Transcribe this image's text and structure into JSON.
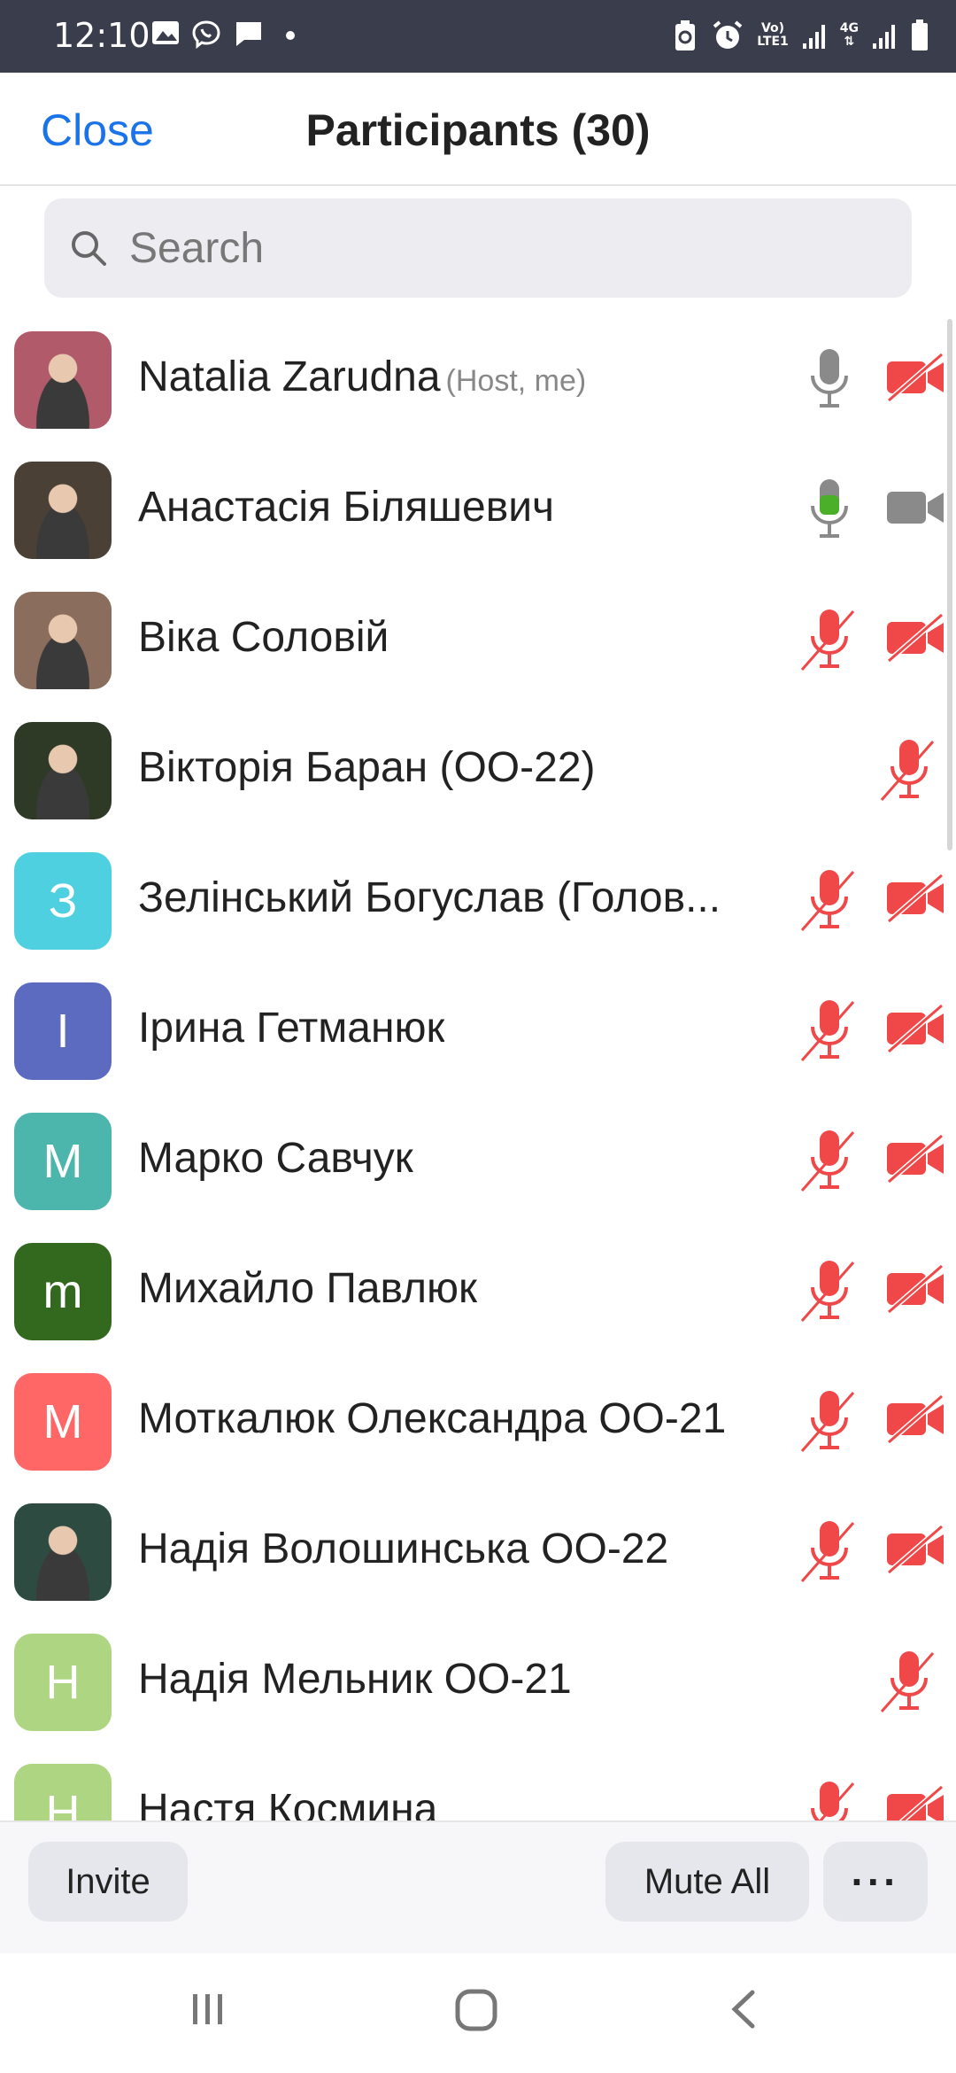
{
  "status_bar": {
    "time": "12:10",
    "network": "Vo) LTE1",
    "network_top": "Vo)",
    "network_bottom": "LTE1",
    "data_type": "4G"
  },
  "header": {
    "close_label": "Close",
    "title": "Participants (30)"
  },
  "search": {
    "placeholder": "Search"
  },
  "participants": [
    {
      "name": "Natalia Zarudna",
      "role": "(Host, me)",
      "mic": "gray",
      "video": "off",
      "avatar": {
        "type": "photo",
        "color": "#b05a6a"
      }
    },
    {
      "name": "Анастасія Біляшевич",
      "role": "",
      "mic": "active",
      "video": "on",
      "avatar": {
        "type": "photo",
        "color": "#4a4036"
      }
    },
    {
      "name": "Віка Соловій",
      "role": "",
      "mic": "muted",
      "video": "off",
      "avatar": {
        "type": "photo",
        "color": "#8a6d5c"
      }
    },
    {
      "name": "Вікторія Баран (ОО-22)",
      "role": "",
      "mic": "muted",
      "video": "none",
      "avatar": {
        "type": "photo",
        "color": "#2f3a26"
      }
    },
    {
      "name": "Зелінський Богуслав (Голов...",
      "role": "",
      "mic": "muted",
      "video": "off",
      "avatar": {
        "type": "initial",
        "letter": "З",
        "color": "#4fd0e0"
      }
    },
    {
      "name": "Ірина Гетманюк",
      "role": "",
      "mic": "muted",
      "video": "off",
      "avatar": {
        "type": "initial",
        "letter": "І",
        "color": "#5c6bc0"
      }
    },
    {
      "name": "Марко Савчук",
      "role": "",
      "mic": "muted",
      "video": "off",
      "avatar": {
        "type": "initial",
        "letter": "М",
        "color": "#4db6ac"
      }
    },
    {
      "name": "Михайло Павлюк",
      "role": "",
      "mic": "muted",
      "video": "off",
      "avatar": {
        "type": "initial",
        "letter": "m",
        "color": "#33691e"
      }
    },
    {
      "name": "Моткалюк Олександра ОО-21",
      "role": "",
      "mic": "muted",
      "video": "off",
      "avatar": {
        "type": "initial",
        "letter": "М",
        "color": "#ff6666"
      }
    },
    {
      "name": "Надія Волошинська ОО-22",
      "role": "",
      "mic": "muted",
      "video": "off",
      "avatar": {
        "type": "photo",
        "color": "#2e4b42"
      }
    },
    {
      "name": "Надія Мельник ОО-21",
      "role": "",
      "mic": "muted",
      "video": "none",
      "avatar": {
        "type": "initial",
        "letter": "Н",
        "color": "#aed581"
      }
    },
    {
      "name": "Настя Космина",
      "role": "",
      "mic": "muted",
      "video": "off",
      "avatar": {
        "type": "initial",
        "letter": "Н",
        "color": "#aed581"
      }
    }
  ],
  "toolbar": {
    "invite_label": "Invite",
    "mute_all_label": "Mute All",
    "more_label": "···"
  },
  "colors": {
    "accent": "#1a73e8",
    "muted_red": "#f04848",
    "active_green": "#4caf2a",
    "status_bar": "#3a3d4c"
  },
  "icons": {
    "status": [
      "image-icon",
      "viber-icon",
      "message-icon",
      "dot-icon",
      "battery-saver-icon",
      "alarm-icon",
      "signal-icon",
      "signal-icon-2",
      "battery-icon"
    ],
    "nav": [
      "recents-icon",
      "home-icon",
      "back-icon"
    ]
  }
}
